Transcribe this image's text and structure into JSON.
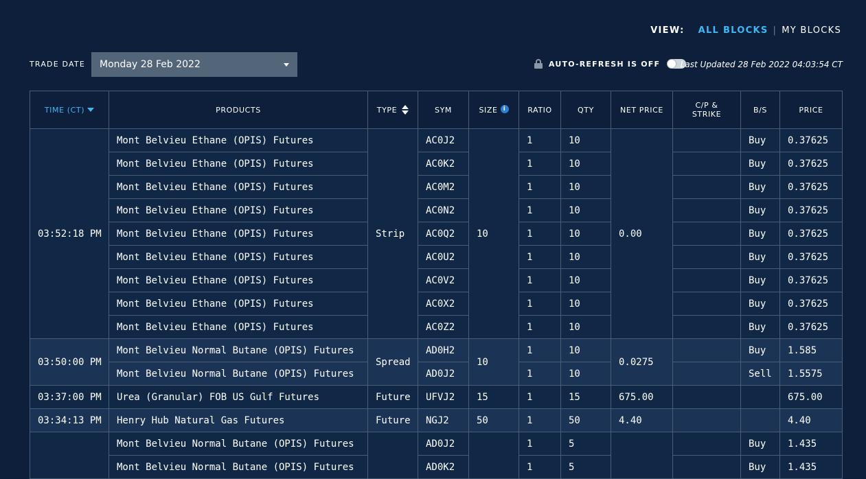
{
  "view": {
    "label": "VIEW:",
    "all": "ALL BLOCKS",
    "separator": "|",
    "mine": "MY BLOCKS"
  },
  "filters": {
    "trade_date_label": "TRADE DATE",
    "trade_date_value": "Monday 28 Feb 2022",
    "auto_refresh_label": "AUTO-REFRESH IS OFF",
    "last_updated": "Last Updated 28 Feb 2022 04:03:54 CT"
  },
  "columns": [
    "TIME (CT)",
    "PRODUCTS",
    "TYPE",
    "SYM",
    "SIZE",
    "RATIO",
    "QTY",
    "NET PRICE",
    "C/P &",
    "STRIKE",
    "B/S",
    "PRICE"
  ],
  "info_glyph": "i",
  "colors": {
    "background": "#0d1f3a",
    "accent": "#3fb7f5",
    "row_alt": "#1b3354",
    "border": "#4a5d77"
  },
  "groups": [
    {
      "time": "03:52:18 PM",
      "type": "Strip",
      "size": "10",
      "net_price": "0.00",
      "legs": [
        {
          "product": "Mont Belvieu Ethane (OPIS) Futures",
          "sym": "AC0J2",
          "ratio": "1",
          "qty": "10",
          "bs": "Buy",
          "price": "0.37625"
        },
        {
          "product": "Mont Belvieu Ethane (OPIS) Futures",
          "sym": "AC0K2",
          "ratio": "1",
          "qty": "10",
          "bs": "Buy",
          "price": "0.37625"
        },
        {
          "product": "Mont Belvieu Ethane (OPIS) Futures",
          "sym": "AC0M2",
          "ratio": "1",
          "qty": "10",
          "bs": "Buy",
          "price": "0.37625"
        },
        {
          "product": "Mont Belvieu Ethane (OPIS) Futures",
          "sym": "AC0N2",
          "ratio": "1",
          "qty": "10",
          "bs": "Buy",
          "price": "0.37625"
        },
        {
          "product": "Mont Belvieu Ethane (OPIS) Futures",
          "sym": "AC0Q2",
          "ratio": "1",
          "qty": "10",
          "bs": "Buy",
          "price": "0.37625"
        },
        {
          "product": "Mont Belvieu Ethane (OPIS) Futures",
          "sym": "AC0U2",
          "ratio": "1",
          "qty": "10",
          "bs": "Buy",
          "price": "0.37625"
        },
        {
          "product": "Mont Belvieu Ethane (OPIS) Futures",
          "sym": "AC0V2",
          "ratio": "1",
          "qty": "10",
          "bs": "Buy",
          "price": "0.37625"
        },
        {
          "product": "Mont Belvieu Ethane (OPIS) Futures",
          "sym": "AC0X2",
          "ratio": "1",
          "qty": "10",
          "bs": "Buy",
          "price": "0.37625"
        },
        {
          "product": "Mont Belvieu Ethane (OPIS) Futures",
          "sym": "AC0Z2",
          "ratio": "1",
          "qty": "10",
          "bs": "Buy",
          "price": "0.37625"
        }
      ]
    },
    {
      "time": "03:50:00 PM",
      "type": "Spread",
      "size": "10",
      "net_price": "0.0275",
      "legs": [
        {
          "product": "Mont Belvieu Normal Butane (OPIS) Futures",
          "sym": "AD0H2",
          "ratio": "1",
          "qty": "10",
          "bs": "Buy",
          "price": "1.585"
        },
        {
          "product": "Mont Belvieu Normal Butane (OPIS) Futures",
          "sym": "AD0J2",
          "ratio": "1",
          "qty": "10",
          "bs": "Sell",
          "price": "1.5575"
        }
      ]
    },
    {
      "time": "03:37:00 PM",
      "type": "Future",
      "size": "15",
      "net_price": "675.00",
      "legs": [
        {
          "product": "Urea (Granular) FOB US Gulf Futures",
          "sym": "UFVJ2",
          "ratio": "1",
          "qty": "15",
          "bs": "",
          "price": "675.00"
        }
      ]
    },
    {
      "time": "03:34:13 PM",
      "type": "Future",
      "size": "50",
      "net_price": "4.40",
      "legs": [
        {
          "product": "Henry Hub Natural Gas Futures",
          "sym": "NGJ2",
          "ratio": "1",
          "qty": "50",
          "bs": "",
          "price": "4.40"
        }
      ]
    },
    {
      "time": "",
      "type": "",
      "size": "",
      "net_price": "",
      "legs": [
        {
          "product": "Mont Belvieu Normal Butane (OPIS) Futures",
          "sym": "AD0J2",
          "ratio": "1",
          "qty": "5",
          "bs": "Buy",
          "price": "1.435"
        },
        {
          "product": "Mont Belvieu Normal Butane (OPIS) Futures",
          "sym": "AD0K2",
          "ratio": "1",
          "qty": "5",
          "bs": "Buy",
          "price": "1.435"
        }
      ]
    }
  ]
}
